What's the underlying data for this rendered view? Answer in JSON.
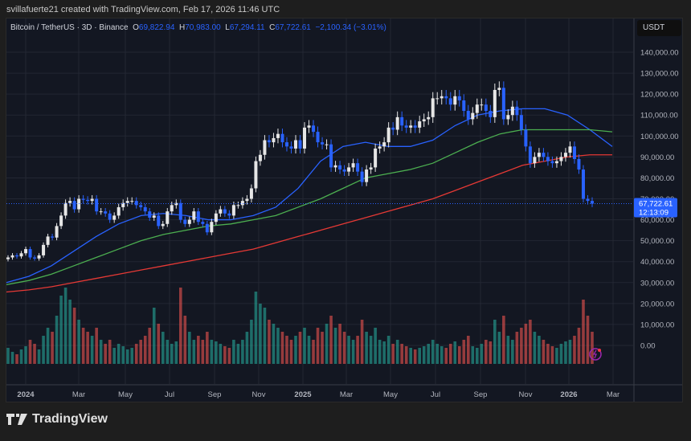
{
  "credit": "svillafuerte21 created with TradingView.com, Feb 17, 2026 11:46 UTC",
  "legend": {
    "symbol": "Bitcoin / TetherUS · 3D · Binance",
    "o_label": "O",
    "o": "69,822.94",
    "h_label": "H",
    "h": "70,983.00",
    "l_label": "L",
    "l": "67,294.11",
    "c_label": "C",
    "c": "67,722.61",
    "change": "−2,100.34 (−3.01%)"
  },
  "currency": "USDT",
  "last_price": {
    "price": "67,722.61",
    "countdown": "12:13:09"
  },
  "brand": "TradingView",
  "colors": {
    "up": "#e6e6e6",
    "down": "#2962ff",
    "vol_up": "#26a69a",
    "vol_down": "#ef5350",
    "ma_fast": "#2962ff",
    "ma_mid": "#4caf50",
    "ma_slow": "#e53935"
  },
  "chart_data": {
    "type": "candlestick",
    "ylim": [
      0,
      140000
    ],
    "y_ticks": [
      "140,000.00",
      "130,000.00",
      "120,000.00",
      "110,000.00",
      "100,000.00",
      "90,000.00",
      "80,000.00",
      "70,000.00",
      "60,000.00",
      "50,000.00",
      "40,000.00",
      "30,000.00",
      "20,000.00",
      "10,000.00",
      "0.00"
    ],
    "x_ticks": [
      "2024",
      "Mar",
      "May",
      "Jul",
      "Sep",
      "Nov",
      "2025",
      "Mar",
      "May",
      "Jul",
      "Sep",
      "Nov",
      "2026",
      "Mar"
    ],
    "grid": true,
    "closes_k": [
      42,
      43,
      42.5,
      44,
      46,
      42,
      41.5,
      43,
      48,
      52,
      51.5,
      57,
      62,
      68,
      69,
      65,
      70,
      69.5,
      69,
      70,
      64,
      64,
      63,
      60,
      62,
      66,
      68,
      69,
      69,
      67,
      66,
      64,
      61,
      62,
      57,
      58,
      64,
      67,
      68,
      60,
      58,
      60,
      64,
      59,
      58,
      54,
      59,
      63,
      65,
      63,
      62,
      67,
      67,
      69,
      70,
      75,
      88,
      91,
      98,
      97,
      99,
      101,
      97,
      95,
      94,
      98,
      94,
      104,
      105,
      102,
      97,
      96,
      96,
      85,
      86,
      84,
      83,
      85,
      87,
      83,
      78,
      84,
      85,
      94,
      95,
      97,
      104,
      103,
      109,
      105,
      104,
      105,
      104,
      107,
      108,
      109,
      118,
      118,
      119,
      118,
      115,
      119,
      117,
      112,
      108,
      111,
      115,
      115,
      112,
      109,
      122,
      123,
      108,
      110,
      114,
      110,
      103,
      95,
      87,
      90,
      92,
      90,
      88,
      87,
      88,
      90,
      92,
      95,
      89,
      84,
      70,
      69,
      67.7
    ],
    "volume_rel": [
      20,
      15,
      12,
      18,
      22,
      30,
      25,
      18,
      35,
      45,
      40,
      60,
      85,
      95,
      80,
      70,
      55,
      45,
      40,
      35,
      45,
      30,
      25,
      30,
      20,
      25,
      22,
      18,
      20,
      25,
      30,
      35,
      45,
      70,
      50,
      40,
      30,
      25,
      28,
      95,
      60,
      40,
      30,
      35,
      30,
      40,
      30,
      28,
      25,
      22,
      20,
      30,
      25,
      30,
      40,
      55,
      90,
      75,
      70,
      55,
      50,
      45,
      40,
      35,
      30,
      35,
      40,
      45,
      35,
      30,
      45,
      40,
      50,
      60,
      45,
      50,
      40,
      35,
      30,
      35,
      55,
      40,
      35,
      45,
      30,
      28,
      35,
      25,
      30,
      25,
      22,
      20,
      18,
      20,
      22,
      25,
      30,
      25,
      22,
      20,
      25,
      28,
      22,
      30,
      35,
      22,
      20,
      25,
      30,
      28,
      55,
      40,
      60,
      35,
      30,
      40,
      45,
      50,
      55,
      40,
      35,
      30,
      25,
      22,
      20,
      25,
      28,
      30,
      35,
      45,
      80,
      60,
      40
    ],
    "ma_fast_k": [
      30,
      33,
      38,
      45,
      52,
      58,
      62,
      63,
      62,
      60,
      60,
      62,
      66,
      75,
      88,
      95,
      97,
      95,
      95,
      98,
      105,
      110,
      112,
      113,
      113,
      110,
      103,
      95
    ],
    "ma_mid_k": [
      29,
      31,
      34,
      38,
      42,
      46,
      50,
      53,
      55,
      57,
      58,
      60,
      62,
      66,
      70,
      75,
      80,
      82,
      84,
      87,
      92,
      97,
      101,
      103,
      103,
      103,
      103,
      102
    ],
    "ma_slow_k": [
      25.5,
      26.5,
      28,
      30,
      32,
      34,
      36,
      38,
      40,
      42,
      44,
      46,
      49,
      52,
      55,
      58,
      61,
      64,
      67,
      70,
      74,
      78,
      82,
      86,
      88,
      90,
      91,
      91
    ]
  }
}
